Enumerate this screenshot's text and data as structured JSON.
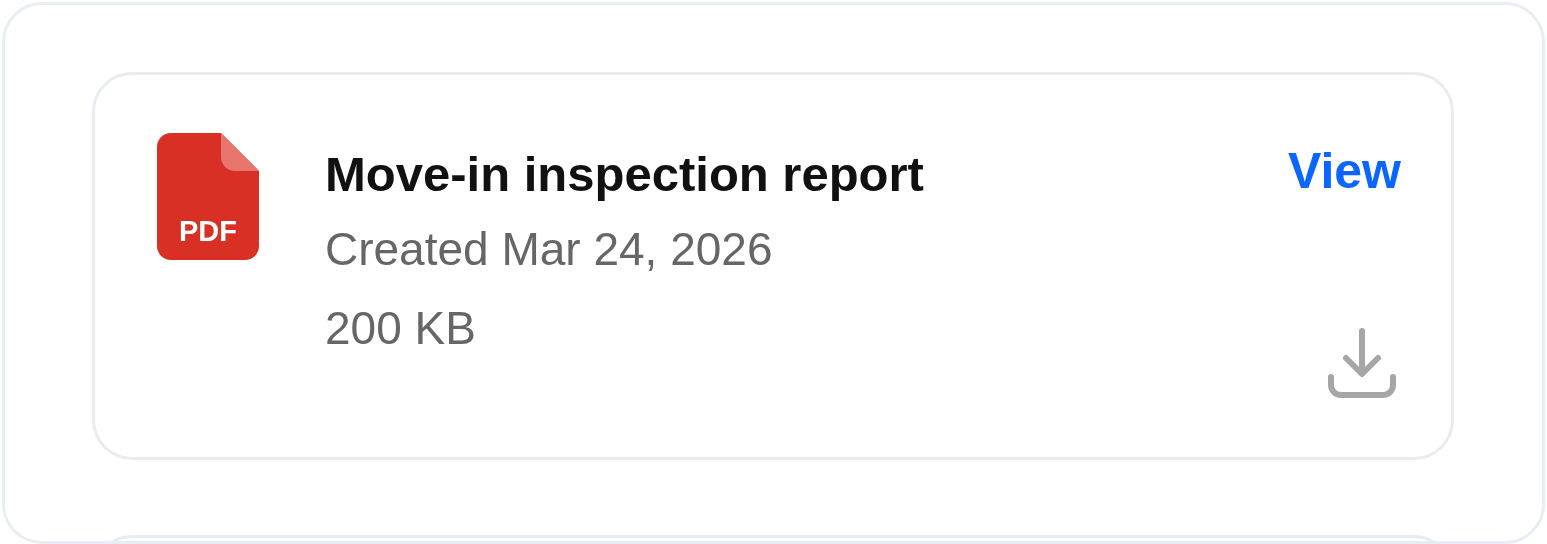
{
  "documents": [
    {
      "file_type": "PDF",
      "title": "Move-in inspection report",
      "created": "Created Mar 24, 2026",
      "size": "200 KB",
      "action": "View"
    }
  ]
}
